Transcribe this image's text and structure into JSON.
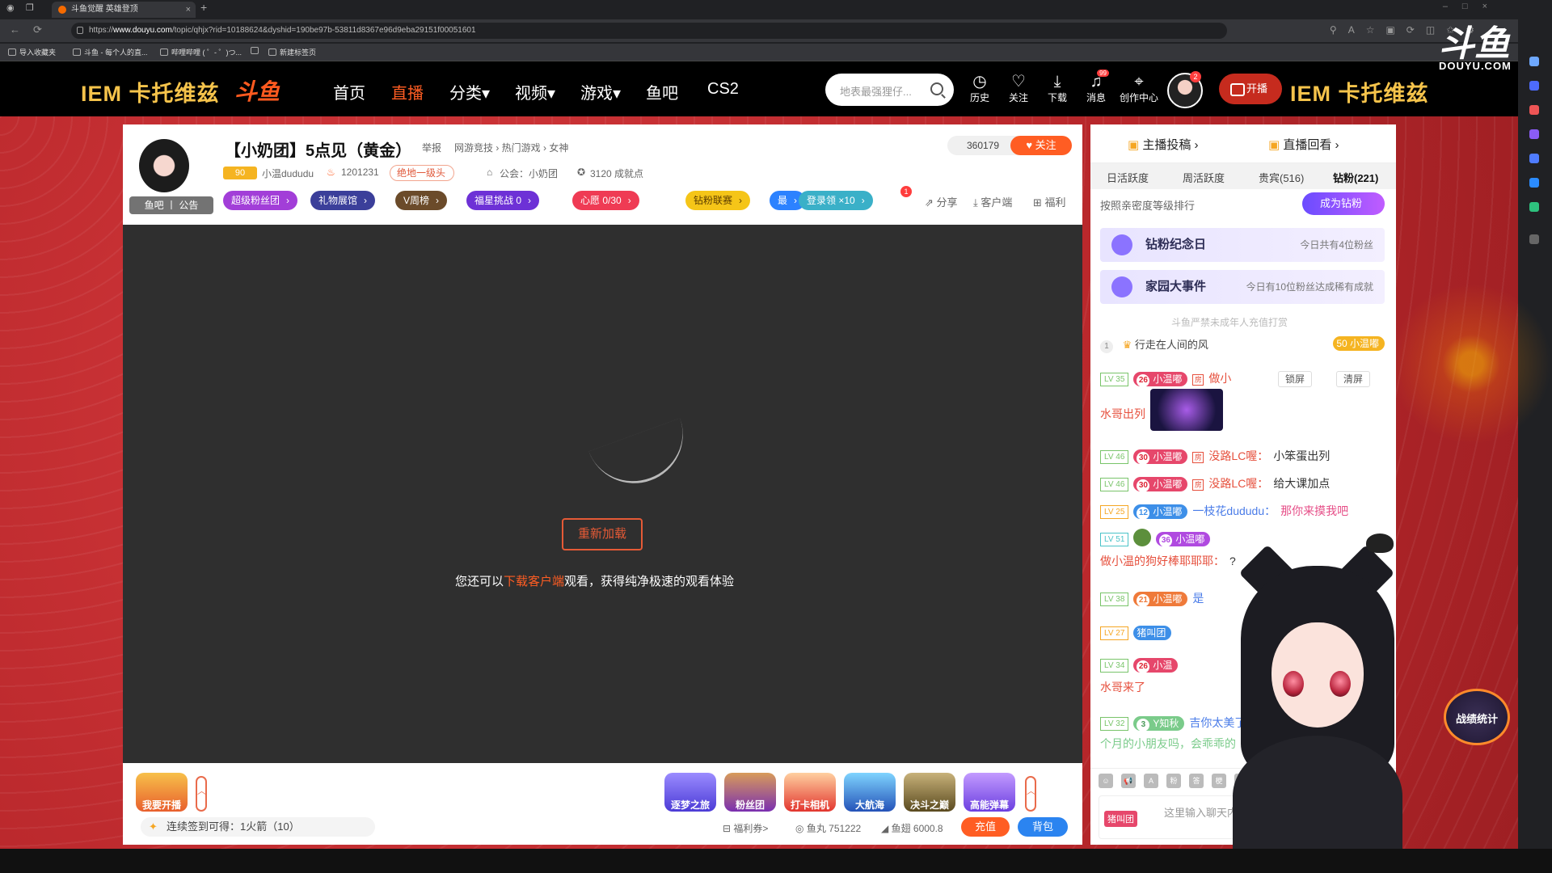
{
  "browser": {
    "tab_title": "斗鱼觉醒 英雄登顶",
    "url_prefix": "https://",
    "url_domain": "www.douyu.com",
    "url_path": "/topic/qhjx?rid=10188624&dyshid=190be97b-53811d8367e96d9eba29151f00051601",
    "bookmarks": [
      "导入收藏夹",
      "斗鱼 - 每个人的直...",
      "哔哩哔哩 ( ゜- ゜)つ...",
      "新建标签页"
    ]
  },
  "nav": {
    "brand": "IEM 卡托维兹",
    "logo": "斗鱼",
    "links": [
      "首页",
      "直播",
      "分类▾",
      "视频▾",
      "游戏▾",
      "鱼吧",
      "CS2"
    ],
    "search_placeholder": "地表最强狸仔...",
    "icons": [
      {
        "label": "历史",
        "icon": "clock-icon"
      },
      {
        "label": "关注",
        "icon": "heart-icon"
      },
      {
        "label": "下载",
        "icon": "download-icon"
      },
      {
        "label": "消息",
        "icon": "bell-icon",
        "badge": "99"
      },
      {
        "label": "创作中心",
        "icon": "pin-icon"
      }
    ],
    "avatar_badge": "2",
    "go_live": "开播",
    "right_brand": "IEM 卡托维兹",
    "corner_logo": "斗鱼",
    "corner_text": "DOUYU.COM"
  },
  "room": {
    "title": "【小奶团】5点见（黄金）",
    "report": "举报",
    "category": "网游竞技 › 热门游戏 › 女神",
    "level": "90",
    "anchor_name": "小温dududu",
    "hot": "1201231",
    "tier": "绝地一级头",
    "guild": "公会：小奶团",
    "achievement": "3120 成就点",
    "avatar_bar": "鱼吧 丨 公告",
    "follow_count": "360179",
    "follow_label": "关注",
    "pills": [
      {
        "label": "超级粉丝团",
        "color": "#a23ed8"
      },
      {
        "label": "礼物展馆",
        "color": "#3b3f9a"
      },
      {
        "label": "V周榜",
        "color": "#6b4b2a"
      },
      {
        "label": "福星挑战 0",
        "color": "#6d31d6"
      },
      {
        "label": "心愿 0/30",
        "color": "#ef3b54"
      },
      {
        "label": "钻粉联赛",
        "color": "#f5c518"
      },
      {
        "label": "最",
        "color": "#2c82ff"
      }
    ],
    "login_reward": "登录领 ×10",
    "login_badge": "1",
    "actions": [
      "分享",
      "客户端",
      "福利"
    ]
  },
  "player": {
    "reload": "重新加载",
    "hint_pre": "您还可以",
    "hint_link": "下载客户端",
    "hint_post": "观看，获得纯净极速的观看体验"
  },
  "bottom": {
    "start_live": "我要开播",
    "features": [
      "逐梦之旅",
      "粉丝团",
      "打卡相机",
      "大航海",
      "决斗之巅",
      "高能弹幕"
    ],
    "checkin": "连续签到可得：1火箭（10）",
    "welfare": "福利券>",
    "fish_ball": "鱼丸 751222",
    "fish_fin": "鱼翅 6000.8",
    "charge": "充值",
    "bag": "背包"
  },
  "chat": {
    "tabs": [
      "主播投稿 ›",
      "直播回看 ›"
    ],
    "rank_tabs": [
      "日活跃度",
      "周活跃度",
      "贵宾(516)",
      "钻粉(221)"
    ],
    "sort_hint": "按照亲密度等级排行",
    "diamond_btn": "成为钻粉",
    "banner1_title": "钻粉纪念日",
    "banner1_right": "今日共有4位粉丝",
    "banner2_title": "家园大事件",
    "banner2_right": "今日有10位粉丝达成稀有成就",
    "notice": "斗鱼严禁未成年人充值打赏",
    "rank_no": "1",
    "rank_name": "行走在人间的风",
    "rank_fan": "50 小温嘟",
    "lock_btn": "锁屏",
    "clear_btn": "清屏",
    "messages": [
      {
        "lv": "LV 35",
        "fan_lv": "26",
        "fan": "小温嘟",
        "nick": "做小",
        "msg": ""
      },
      {
        "lv": "",
        "fan_lv": "",
        "fan": "",
        "nick": "水哥出列",
        "msg": ""
      },
      {
        "lv": "LV 46",
        "fan_lv": "30",
        "fan": "小温嘟",
        "nick": "没路LC喔：",
        "msg": "小笨蛋出列"
      },
      {
        "lv": "LV 46",
        "fan_lv": "30",
        "fan": "小温嘟",
        "nick": "没路LC喔：",
        "msg": "给大课加点"
      },
      {
        "lv": "LV 25",
        "fan_lv": "12",
        "fan": "小温嘟",
        "nick": "一枝花dududu：",
        "msg": "那你来摸我吧"
      },
      {
        "lv": "LV 51",
        "fan_lv": "36",
        "fan": "小温嘟",
        "nick": "",
        "msg": ""
      },
      {
        "lv": "",
        "fan_lv": "",
        "fan": "",
        "nick": "做小温的狗好棒耶耶耶：",
        "msg": "?"
      },
      {
        "lv": "LV 38",
        "fan_lv": "21",
        "fan": "小温嘟",
        "nick": "是",
        "msg": ""
      },
      {
        "lv": "LV 27",
        "fan_lv": "",
        "fan": "猪叫团",
        "nick": "",
        "msg": ""
      },
      {
        "lv": "LV 34",
        "fan_lv": "26",
        "fan": "小温",
        "nick": "",
        "msg": ""
      },
      {
        "lv": "",
        "fan_lv": "",
        "fan": "",
        "nick": "水哥来了",
        "msg": ""
      },
      {
        "lv": "LV 32",
        "fan_lv": "3",
        "fan": "Y知秋",
        "nick": "吉你太美了：",
        "msg": ""
      },
      {
        "lv": "",
        "fan_lv": "",
        "fan": "",
        "nick": "个月的小朋友吗，会乖乖的",
        "msg": ""
      }
    ],
    "tool_labels": [
      "粉",
      "答",
      "梗",
      "令",
      "高能"
    ],
    "input_tag": "猪叫团",
    "input_placeholder": "这里输入聊天内容"
  },
  "overlay": {
    "promo": "战绩统计"
  }
}
